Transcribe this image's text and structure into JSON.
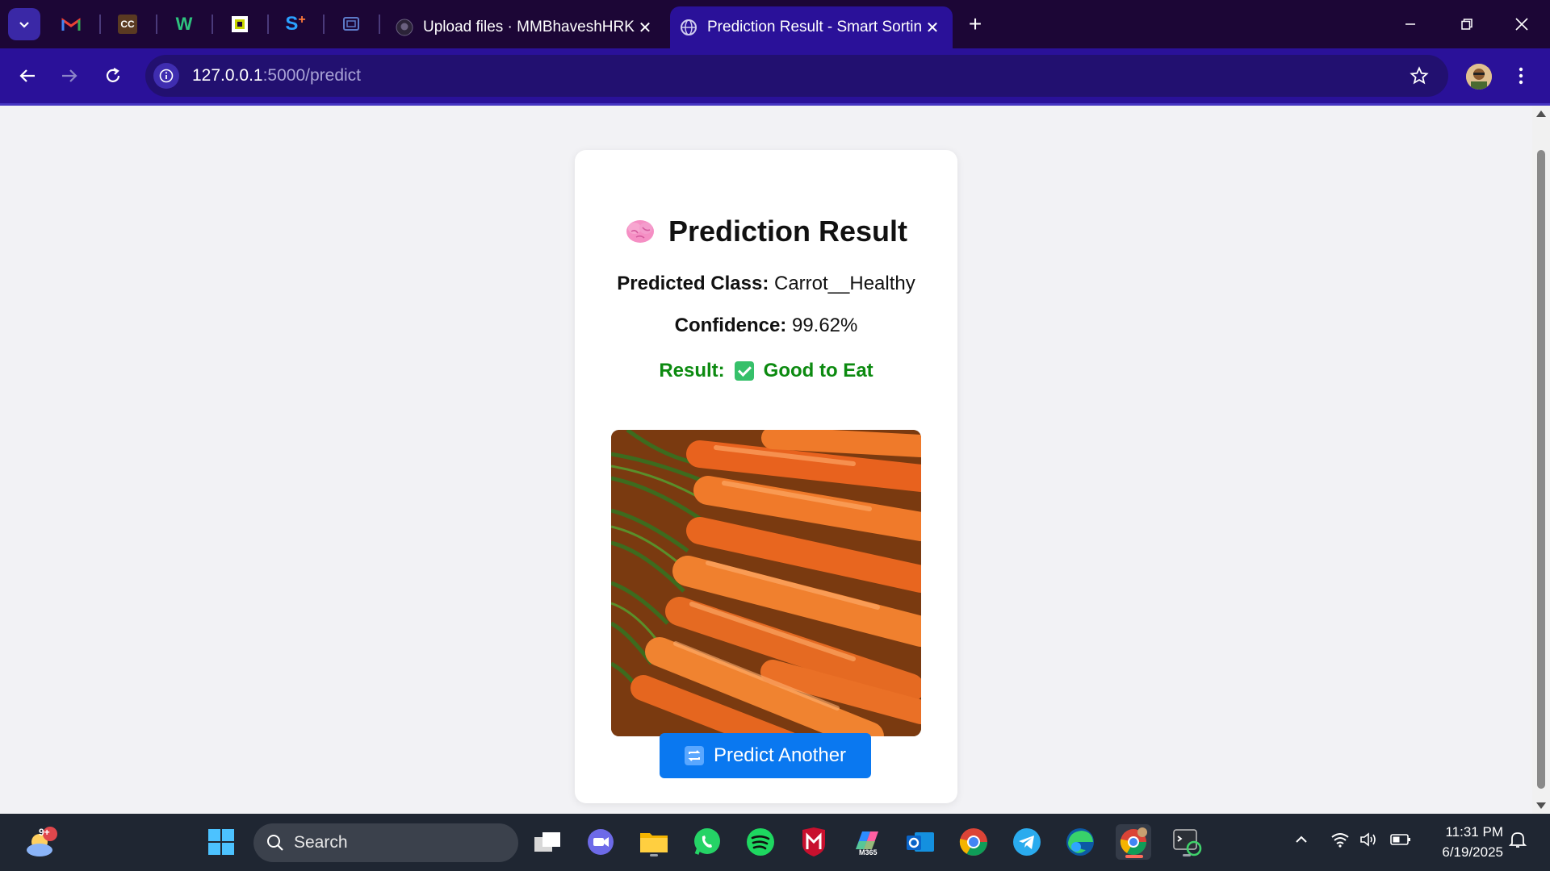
{
  "browser": {
    "tabs": [
      {
        "title": "Upload files · MMBhaveshHRK/",
        "favicon": "github-icon",
        "active": false
      },
      {
        "title": "Prediction Result - Smart Sortin",
        "favicon": "globe-icon",
        "active": true
      }
    ],
    "pinned_tabs": [
      {
        "name": "gmail-icon",
        "label": "M"
      },
      {
        "name": "cc-icon",
        "label": "CC"
      },
      {
        "name": "w-icon",
        "label": "W"
      },
      {
        "name": "sheets-icon",
        "label": ""
      },
      {
        "name": "s-plus-icon",
        "label": "S"
      },
      {
        "name": "screen-icon",
        "label": ""
      }
    ],
    "url_host": "127.0.0.1",
    "url_rest": ":5000/predict"
  },
  "page": {
    "title": "Prediction Result",
    "predicted_label": "Predicted Class:",
    "predicted_value": "Carrot__Healthy",
    "confidence_label": "Confidence:",
    "confidence_value": "99.62%",
    "result_label": "Result:",
    "result_value": "Good to Eat",
    "result_color": "#0c8a10",
    "button_label": "Predict Another",
    "button_color": "#0a78f0"
  },
  "taskbar": {
    "search_placeholder": "Search",
    "weather_badge": "9+",
    "time": "11:31 PM",
    "date": "6/19/2025",
    "apps": [
      "start-icon",
      "task-view-icon",
      "meet-icon",
      "file-explorer-icon",
      "whatsapp-icon",
      "spotify-icon",
      "mcafee-icon",
      "m365-icon",
      "outlook-icon",
      "chrome-icon",
      "telegram-icon",
      "edge-icon",
      "chrome-profile-icon",
      "terminal-icon"
    ],
    "m365_label": "M365"
  }
}
